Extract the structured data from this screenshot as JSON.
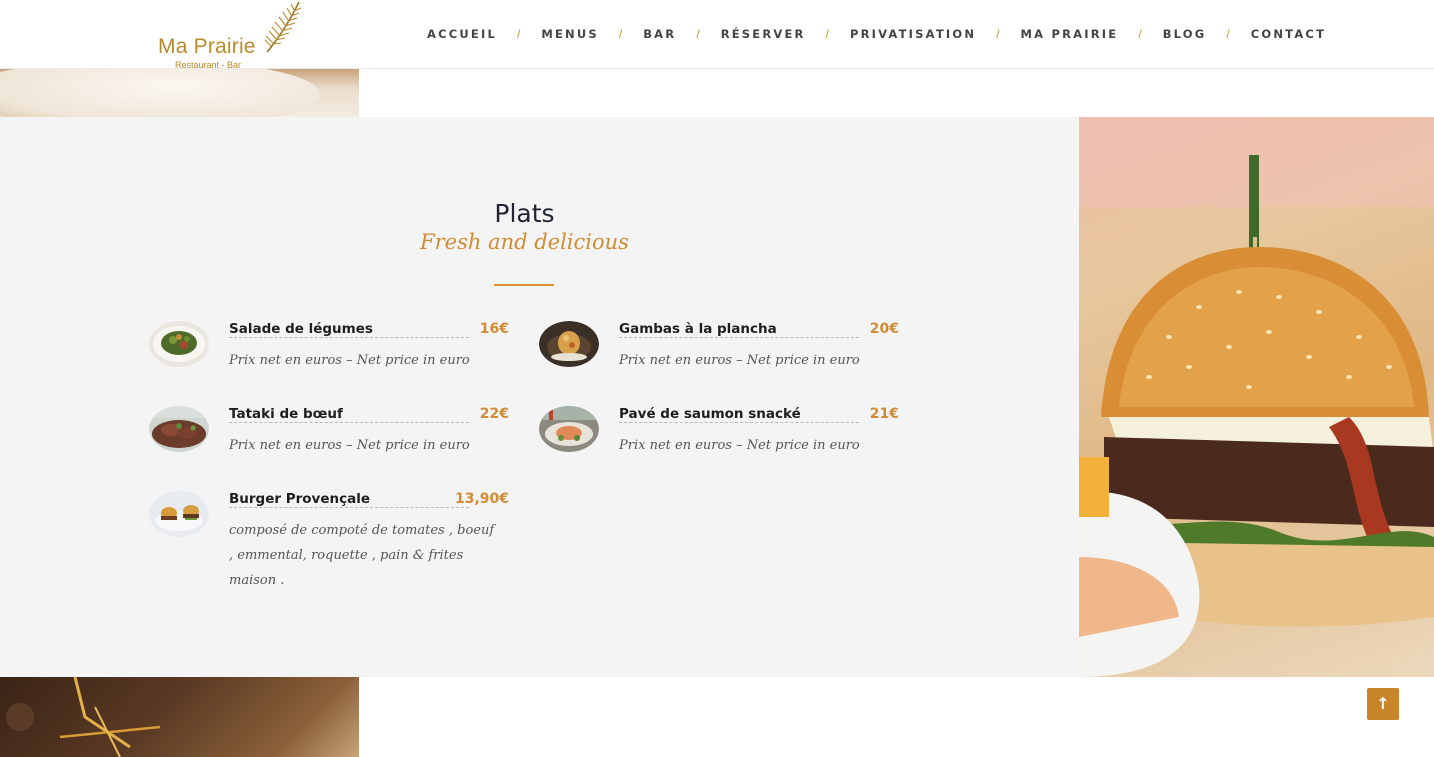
{
  "brand": {
    "name": "Ma Prairie",
    "tagline": "Restaurant - Bar"
  },
  "nav": {
    "separator": "/",
    "items": [
      {
        "label": "ACCUEIL"
      },
      {
        "label": "MENUS"
      },
      {
        "label": "BAR"
      },
      {
        "label": "RÉSERVER"
      },
      {
        "label": "PRIVATISATION"
      },
      {
        "label": "MA PRAIRIE"
      },
      {
        "label": "BLOG"
      },
      {
        "label": "CONTACT"
      }
    ]
  },
  "section": {
    "title": "Plats",
    "subtitle": "Fresh and delicious"
  },
  "dishes": [
    {
      "name": "Salade de légumes",
      "price": "16€",
      "description": "Prix net en euros – Net price in euro"
    },
    {
      "name": "Gambas à la plancha",
      "price": "20€",
      "description": "Prix net en euros – Net price in euro"
    },
    {
      "name": "Tataki de bœuf",
      "price": "22€",
      "description": "Prix net en euros – Net price in euro"
    },
    {
      "name": "Pavé de saumon snacké",
      "price": "21€",
      "description": "Prix net en euros – Net price in euro"
    },
    {
      "name": "Burger Provençale",
      "price": "13,90€",
      "description": "composé de compoté de tomates , boeuf , emmental, roquette , pain & frites maison ."
    }
  ],
  "scroll_top": {
    "icon": "arrow-up-icon",
    "glyph": "↑"
  },
  "colors": {
    "accent": "#d18b32",
    "panel": "#f4f4f4",
    "heading": "#1f2333"
  }
}
